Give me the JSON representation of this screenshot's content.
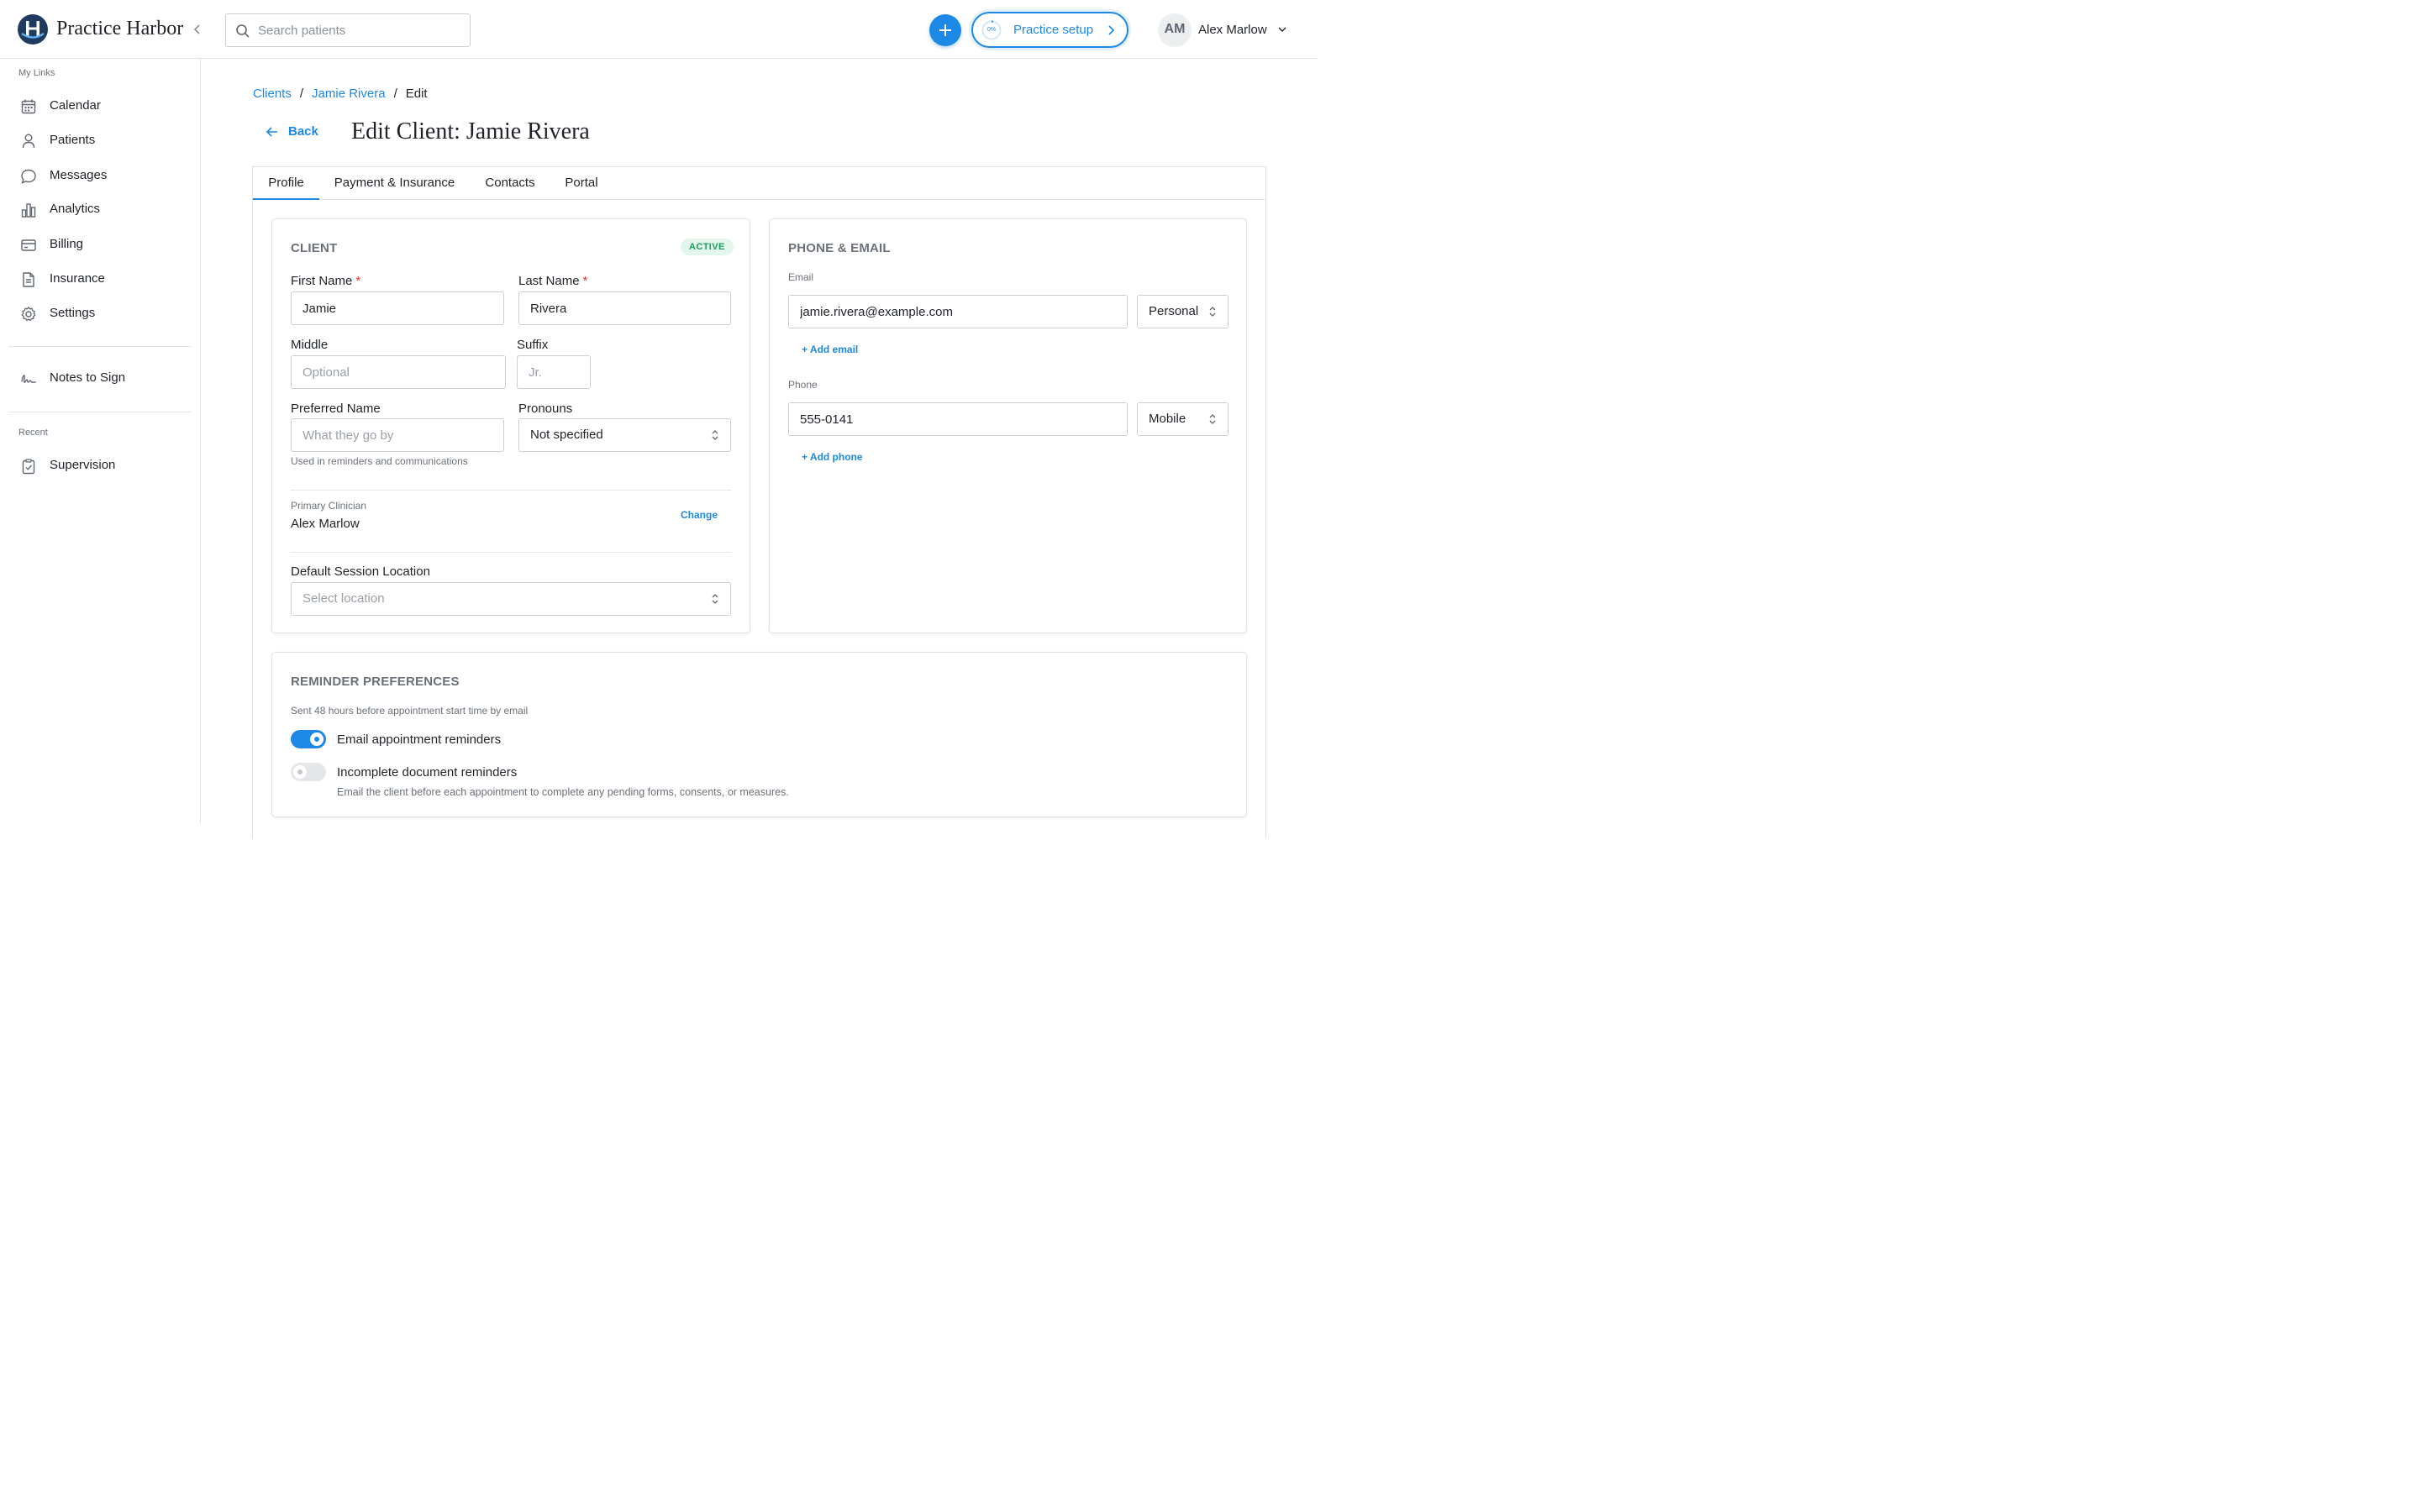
{
  "app": {
    "brand": "Practice Harbor"
  },
  "search": {
    "placeholder": "Search patients"
  },
  "header": {
    "setup_label": "Practice setup",
    "setup_progress": "0%",
    "avatar_initials": "AM",
    "user_name": "Alex Marlow"
  },
  "sidebar": {
    "section_links": "My Links",
    "items": [
      {
        "label": "Calendar",
        "icon": "calendar-icon"
      },
      {
        "label": "Patients",
        "icon": "person-icon"
      },
      {
        "label": "Messages",
        "icon": "chat-bubble-icon"
      },
      {
        "label": "Analytics",
        "icon": "bar-chart-icon"
      },
      {
        "label": "Billing",
        "icon": "credit-card-icon"
      },
      {
        "label": "Insurance",
        "icon": "document-icon"
      },
      {
        "label": "Settings",
        "icon": "gear-icon"
      }
    ],
    "notes_to_sign": "Notes to Sign",
    "section_recent": "Recent",
    "recent": [
      {
        "label": "Supervision",
        "icon": "clipboard-check-icon"
      }
    ]
  },
  "breadcrumb": {
    "clients": "Clients",
    "client": "Jamie Rivera",
    "current": "Edit",
    "separator": "/"
  },
  "page": {
    "back_label": "Back",
    "title": "Edit Client: Jamie Rivera"
  },
  "tabs": [
    {
      "label": "Profile",
      "active": true
    },
    {
      "label": "Payment & Insurance",
      "active": false
    },
    {
      "label": "Contacts",
      "active": false
    },
    {
      "label": "Portal",
      "active": false
    }
  ],
  "client_card": {
    "title": "CLIENT",
    "status": "ACTIVE",
    "first_name": {
      "label": "First Name",
      "value": "Jamie",
      "required_mark": "*"
    },
    "last_name": {
      "label": "Last Name",
      "value": "Rivera",
      "required_mark": "*"
    },
    "middle": {
      "label": "Middle",
      "placeholder": "Optional"
    },
    "suffix": {
      "label": "Suffix",
      "placeholder": "Jr."
    },
    "preferred_name": {
      "label": "Preferred Name",
      "placeholder": "What they go by",
      "help": "Used in reminders and communications"
    },
    "pronouns": {
      "label": "Pronouns",
      "value": "Not specified"
    },
    "primary_clinician": {
      "label": "Primary Clinician",
      "value": "Alex Marlow",
      "change_label": "Change"
    },
    "session_location": {
      "label": "Default Session Location",
      "placeholder": "Select location"
    }
  },
  "contact_card": {
    "title": "PHONE & EMAIL",
    "email": {
      "label": "Email",
      "value": "jamie.rivera@example.com",
      "type": "Personal",
      "add_label": "+ Add email"
    },
    "phone": {
      "label": "Phone",
      "value": "555-0141",
      "type": "Mobile",
      "add_label": "+ Add phone"
    }
  },
  "reminders_card": {
    "title": "REMINDER PREFERENCES",
    "subtitle": "Sent 48 hours before appointment start time by email",
    "email_reminders": {
      "label": "Email appointment reminders",
      "enabled": true
    },
    "document_reminders": {
      "label": "Incomplete document reminders",
      "enabled": false,
      "description": "Email the client before each appointment to complete any pending forms, consents, or measures."
    }
  },
  "colors": {
    "accent": "#1e88e5",
    "success": "#1a9e5a",
    "required": "#e53935",
    "brand_dark": "#1f3a5f"
  }
}
